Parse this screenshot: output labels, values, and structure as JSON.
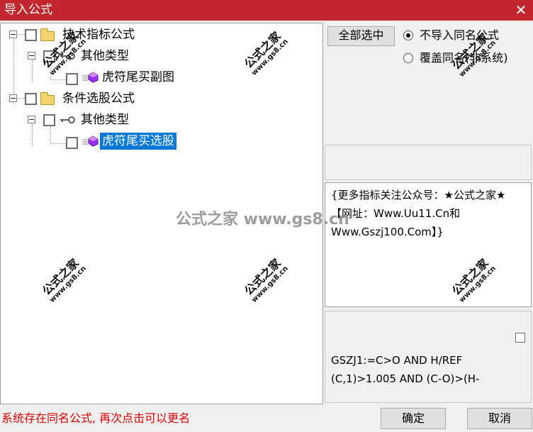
{
  "window": {
    "title": "导入公式",
    "close_glyph": "✕"
  },
  "tree": {
    "nodes": [
      {
        "label": "技术指标公式",
        "icon": "folder-icon",
        "expander": "−"
      },
      {
        "label": "其他类型",
        "icon": "key-icon",
        "expander": "−"
      },
      {
        "label": "虎符尾买副图",
        "icon": "formula-icon"
      },
      {
        "label": "条件选股公式",
        "icon": "folder-icon",
        "expander": "−"
      },
      {
        "label": "其他类型",
        "icon": "key-icon",
        "expander": "−"
      },
      {
        "label": "虎符尾买选股",
        "icon": "formula-icon",
        "selected": true
      }
    ]
  },
  "options": {
    "select_all_label": "全部选中",
    "radio_no_import": "不导入同名公式",
    "radio_overwrite": "覆盖同名(非系统)",
    "selected": "no_import"
  },
  "description": {
    "text": "{更多指标关注公众号：★公式之家★ 【网址：Www.Uu11.Cn和Www.Gszj100.Com】}"
  },
  "code": {
    "text": "GSZJ1:=C>O AND H/REF (C,1)>1.005 AND (C-O)>(H-"
  },
  "status": {
    "message": "系统存在同名公式, 再次点击可以更名"
  },
  "buttons": {
    "ok": "确定",
    "cancel": "取消"
  },
  "watermark": {
    "cn": "公式之家",
    "url": "www.gs8.cn",
    "center": "公式之家 www.gs8.cn"
  },
  "colors": {
    "titlebar": "#c1272d",
    "selection": "#0078d7",
    "status_text": "#e00000",
    "formula_icon": "#9b30ff",
    "folder": "#f3d36b"
  }
}
